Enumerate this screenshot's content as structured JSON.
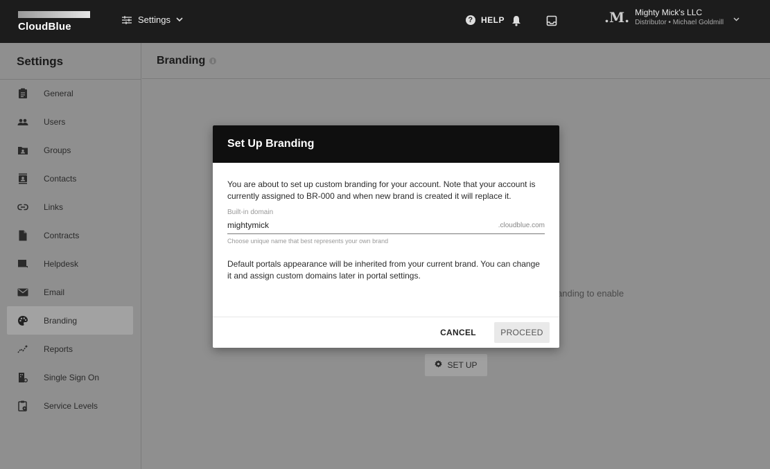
{
  "topbar": {
    "logo_text": "CloudBlue",
    "menu_label": "Settings",
    "help_label": "HELP",
    "help_icon": "?",
    "account": {
      "logo_glyph": ".M.",
      "name": "Mighty Mick's LLC",
      "subtitle": "Distributor • Michael Goldmill"
    }
  },
  "sidebar": {
    "title": "Settings",
    "items": [
      {
        "label": "General",
        "icon": "clipboard-icon"
      },
      {
        "label": "Users",
        "icon": "users-icon"
      },
      {
        "label": "Groups",
        "icon": "groups-icon"
      },
      {
        "label": "Contacts",
        "icon": "contacts-icon"
      },
      {
        "label": "Links",
        "icon": "link-icon"
      },
      {
        "label": "Contracts",
        "icon": "document-icon"
      },
      {
        "label": "Helpdesk",
        "icon": "helpdesk-icon"
      },
      {
        "label": "Email",
        "icon": "mail-icon"
      },
      {
        "label": "Branding",
        "icon": "palette-icon",
        "active": true
      },
      {
        "label": "Reports",
        "icon": "reports-icon"
      },
      {
        "label": "Single Sign On",
        "icon": "sso-icon"
      },
      {
        "label": "Service Levels",
        "icon": "service-levels-icon"
      }
    ]
  },
  "main": {
    "title": "Branding",
    "background_text": "anding to enable",
    "setup_button": "SET UP"
  },
  "modal": {
    "title": "Set Up Branding",
    "intro": "You are about to set up custom branding for your account. Note that your account is currently assigned to BR-000 and when new brand is created it will replace it.",
    "field": {
      "label": "Built-in domain",
      "value": "mightymick",
      "suffix": ".cloudblue.com",
      "hint": "Choose unique name that best represents your own brand"
    },
    "note": "Default portals appearance will be inherited from your current brand. You can change it and assign custom domains later in portal settings.",
    "cancel_label": "CANCEL",
    "proceed_label": "PROCEED"
  },
  "colors": {
    "topbar": "#1c1c1c",
    "overlay": "#8f8f8f",
    "modal_header": "#0f0f0f"
  }
}
